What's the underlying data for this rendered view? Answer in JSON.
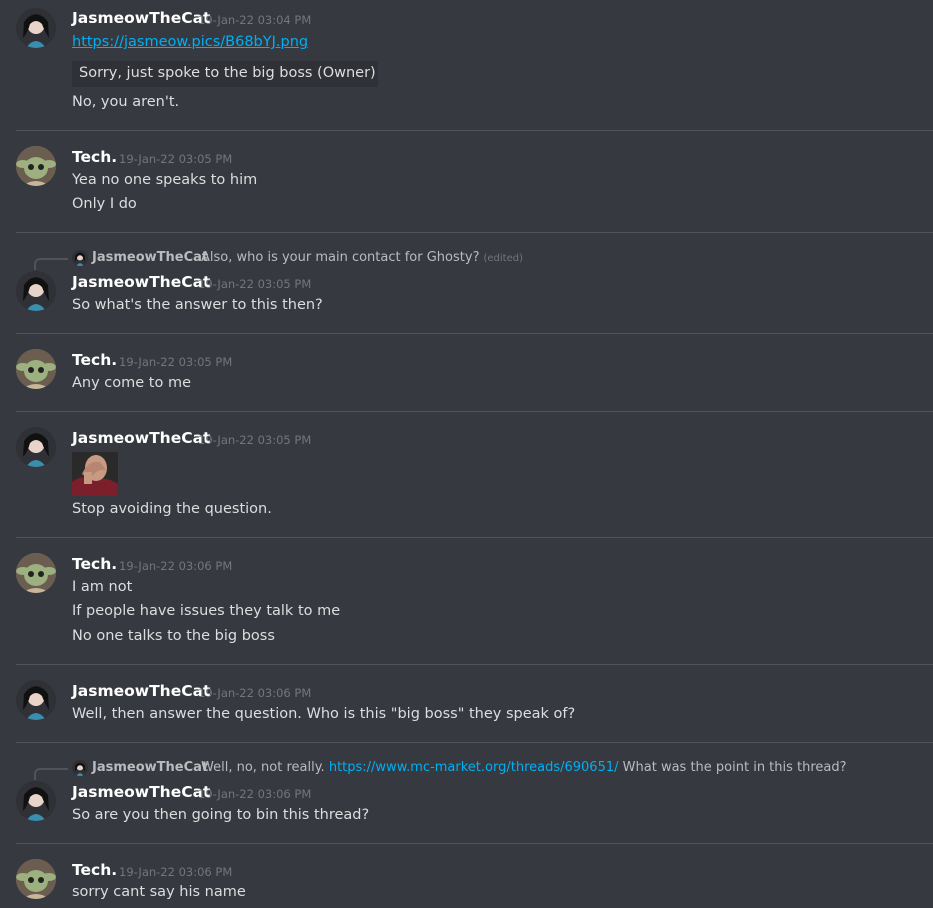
{
  "messages": [
    {
      "author": "JasmeowTheCat",
      "time": "19-Jan-22 03:04 PM",
      "link": "https://jasmeow.pics/B68bYJ.png",
      "quote": "Sorry, just spoke to the big boss (Owner)",
      "lines": [
        "No, you aren't."
      ]
    },
    {
      "author": "Tech.",
      "time": "19-Jan-22 03:05 PM",
      "lines": [
        "Yea no one speaks to him",
        "Only I do"
      ]
    },
    {
      "reply": {
        "author": "JasmeowTheCat",
        "text": "Also, who is your main contact for Ghosty?",
        "edited": "(edited)"
      },
      "author": "JasmeowTheCat",
      "time": "19-Jan-22 03:05 PM",
      "lines": [
        "So what's the answer to this then?"
      ]
    },
    {
      "author": "Tech.",
      "time": "19-Jan-22 03:05 PM",
      "lines": [
        "Any come to me"
      ]
    },
    {
      "author": "JasmeowTheCat",
      "time": "19-Jan-22 03:05 PM",
      "image": "facepalm-image",
      "lines": [
        "Stop avoiding the question."
      ]
    },
    {
      "author": "Tech.",
      "time": "19-Jan-22 03:06 PM",
      "lines": [
        "I am not",
        "If people have issues they talk to me",
        "No one talks to the big boss"
      ]
    },
    {
      "author": "JasmeowTheCat",
      "time": "19-Jan-22 03:06 PM",
      "lines": [
        "Well, then answer the question. Who is this \"big boss\" they speak of?"
      ]
    },
    {
      "reply": {
        "author": "JasmeowTheCat",
        "text_before": "Well, no, not really.",
        "link": "https://www.mc-market.org/threads/690651/",
        "text_after": "What was the point in this thread?"
      },
      "author": "JasmeowTheCat",
      "time": "19-Jan-22 03:06 PM",
      "lines": [
        "So are you then going to bin this thread?"
      ]
    },
    {
      "author": "Tech.",
      "time": "19-Jan-22 03:06 PM",
      "lines": [
        "sorry cant say his name"
      ]
    }
  ]
}
